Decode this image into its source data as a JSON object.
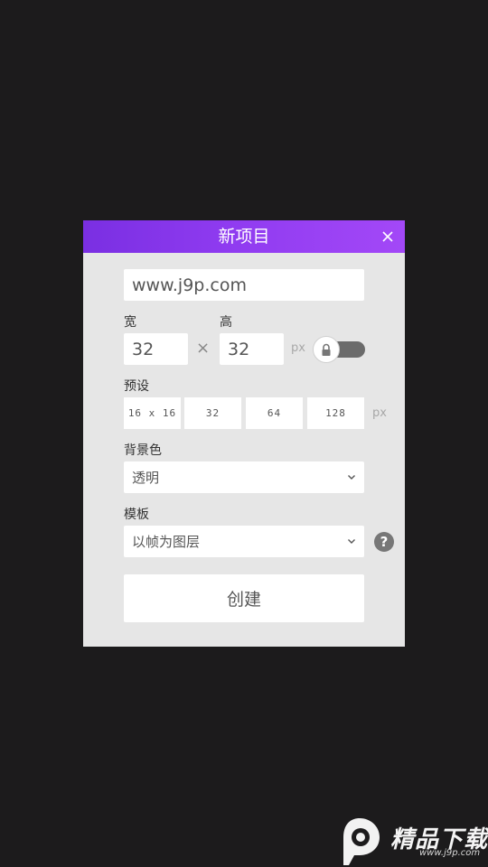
{
  "dialog": {
    "title": "新项目",
    "name_value": "www.j9p.com",
    "width_label": "宽",
    "width_value": "32",
    "height_label": "高",
    "height_value": "32",
    "times_symbol": "×",
    "size_unit": "px",
    "aspect_lock_icon": "lock-icon",
    "presets_label": "预设",
    "presets": [
      "16 x 16",
      "32",
      "64",
      "128"
    ],
    "preset_unit": "px",
    "background_label": "背景色",
    "background_value": "透明",
    "template_label": "模板",
    "template_value": "以帧为图层",
    "help_symbol": "?",
    "create_label": "创建"
  },
  "watermark": {
    "brand": "精品下载",
    "url": "www.j9p.com"
  },
  "colors": {
    "screen_bg": "#1c1b1c",
    "dialog_bg": "#e6e6e6",
    "header_gradient_start": "#7a2fe2",
    "header_gradient_end": "#a348f7",
    "toggle_track": "#6b6b6b"
  }
}
